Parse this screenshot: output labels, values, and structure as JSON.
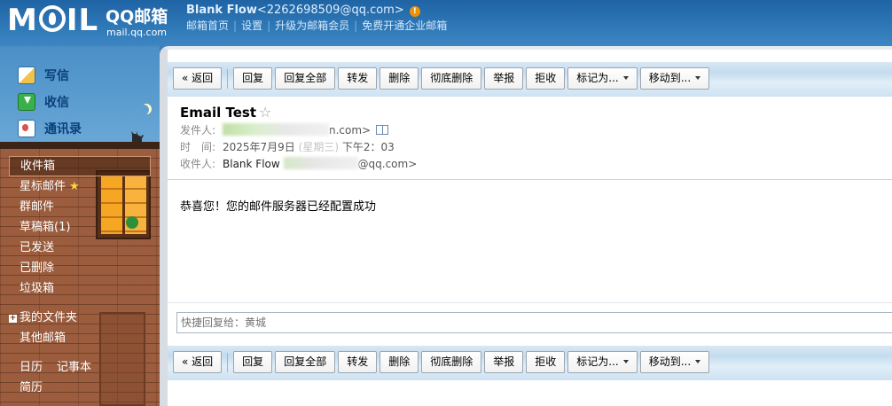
{
  "brand": {
    "logo_text": "MOIL",
    "product": "QQ邮箱",
    "domain": "mail.qq.com"
  },
  "account": {
    "name": "Blank Flow",
    "email": "<2262698509@qq.com>",
    "warning_icon": "!"
  },
  "top_links": [
    "邮箱首页",
    "设置",
    "升级为邮箱会员",
    "免费开通企业邮箱"
  ],
  "sidebar": {
    "primary": [
      {
        "label": "写信",
        "icon": "write-icon"
      },
      {
        "label": "收信",
        "icon": "inbox-icon"
      },
      {
        "label": "通讯录",
        "icon": "contacts-icon"
      }
    ],
    "folders": [
      {
        "label": "收件箱",
        "active": true
      },
      {
        "label": "星标邮件",
        "star": "★"
      },
      {
        "label": "群邮件"
      },
      {
        "label": "草稿箱(1)"
      },
      {
        "label": "已发送"
      },
      {
        "label": "已删除"
      },
      {
        "label": "垃圾箱"
      }
    ],
    "my_folders": "我的文件夹",
    "other_mailboxes": "其他邮箱",
    "tools": [
      "日历",
      "记事本"
    ],
    "resume": "简历"
  },
  "toolbar": {
    "back": "« 返回",
    "reply": "回复",
    "reply_all": "回复全部",
    "forward": "转发",
    "delete": "删除",
    "delete_forever": "彻底删除",
    "report": "举报",
    "reject": "拒收",
    "mark_as": "标记为...",
    "move_to": "移动到..."
  },
  "email": {
    "subject": "Email Test",
    "star": "☆",
    "sender_label": "发件人:",
    "sender_visible": "n.com>",
    "time_label": "时　间:",
    "time_prefix": "2025年7月9日",
    "time_mid": "(星期三)",
    "time_suffix": "下午2：03",
    "recipient_label": "收件人:",
    "recipient_name": "Blank Flow",
    "recipient_visible": "@qq.com>",
    "body": "恭喜您！您的邮件服务器已经配置成功"
  },
  "quick_reply": {
    "placeholder": "快捷回复给：黄城"
  },
  "colors": {
    "header_blue": "#2e77b6",
    "brick": "#9b5d3d",
    "toolbar_blue": "#c4dcef"
  }
}
